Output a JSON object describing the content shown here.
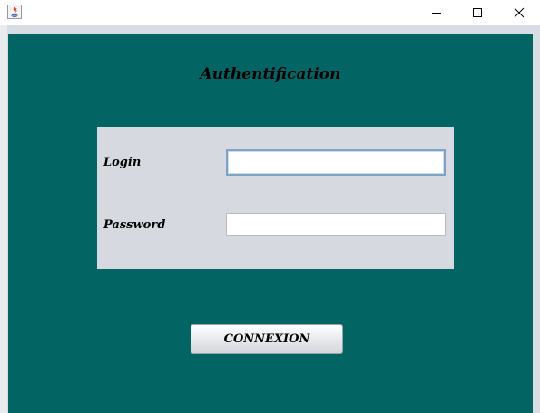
{
  "window": {
    "icon": "java-app-icon",
    "controls": {
      "minimize": "minimize-icon",
      "maximize": "maximize-icon",
      "close": "close-icon"
    }
  },
  "form": {
    "title": "Authentification",
    "login_label": "Login",
    "login_value": "",
    "password_label": "Password",
    "password_value": "",
    "submit_label": "CONNEXION"
  },
  "colors": {
    "background": "#036563",
    "panel": "#d7d9e0"
  }
}
